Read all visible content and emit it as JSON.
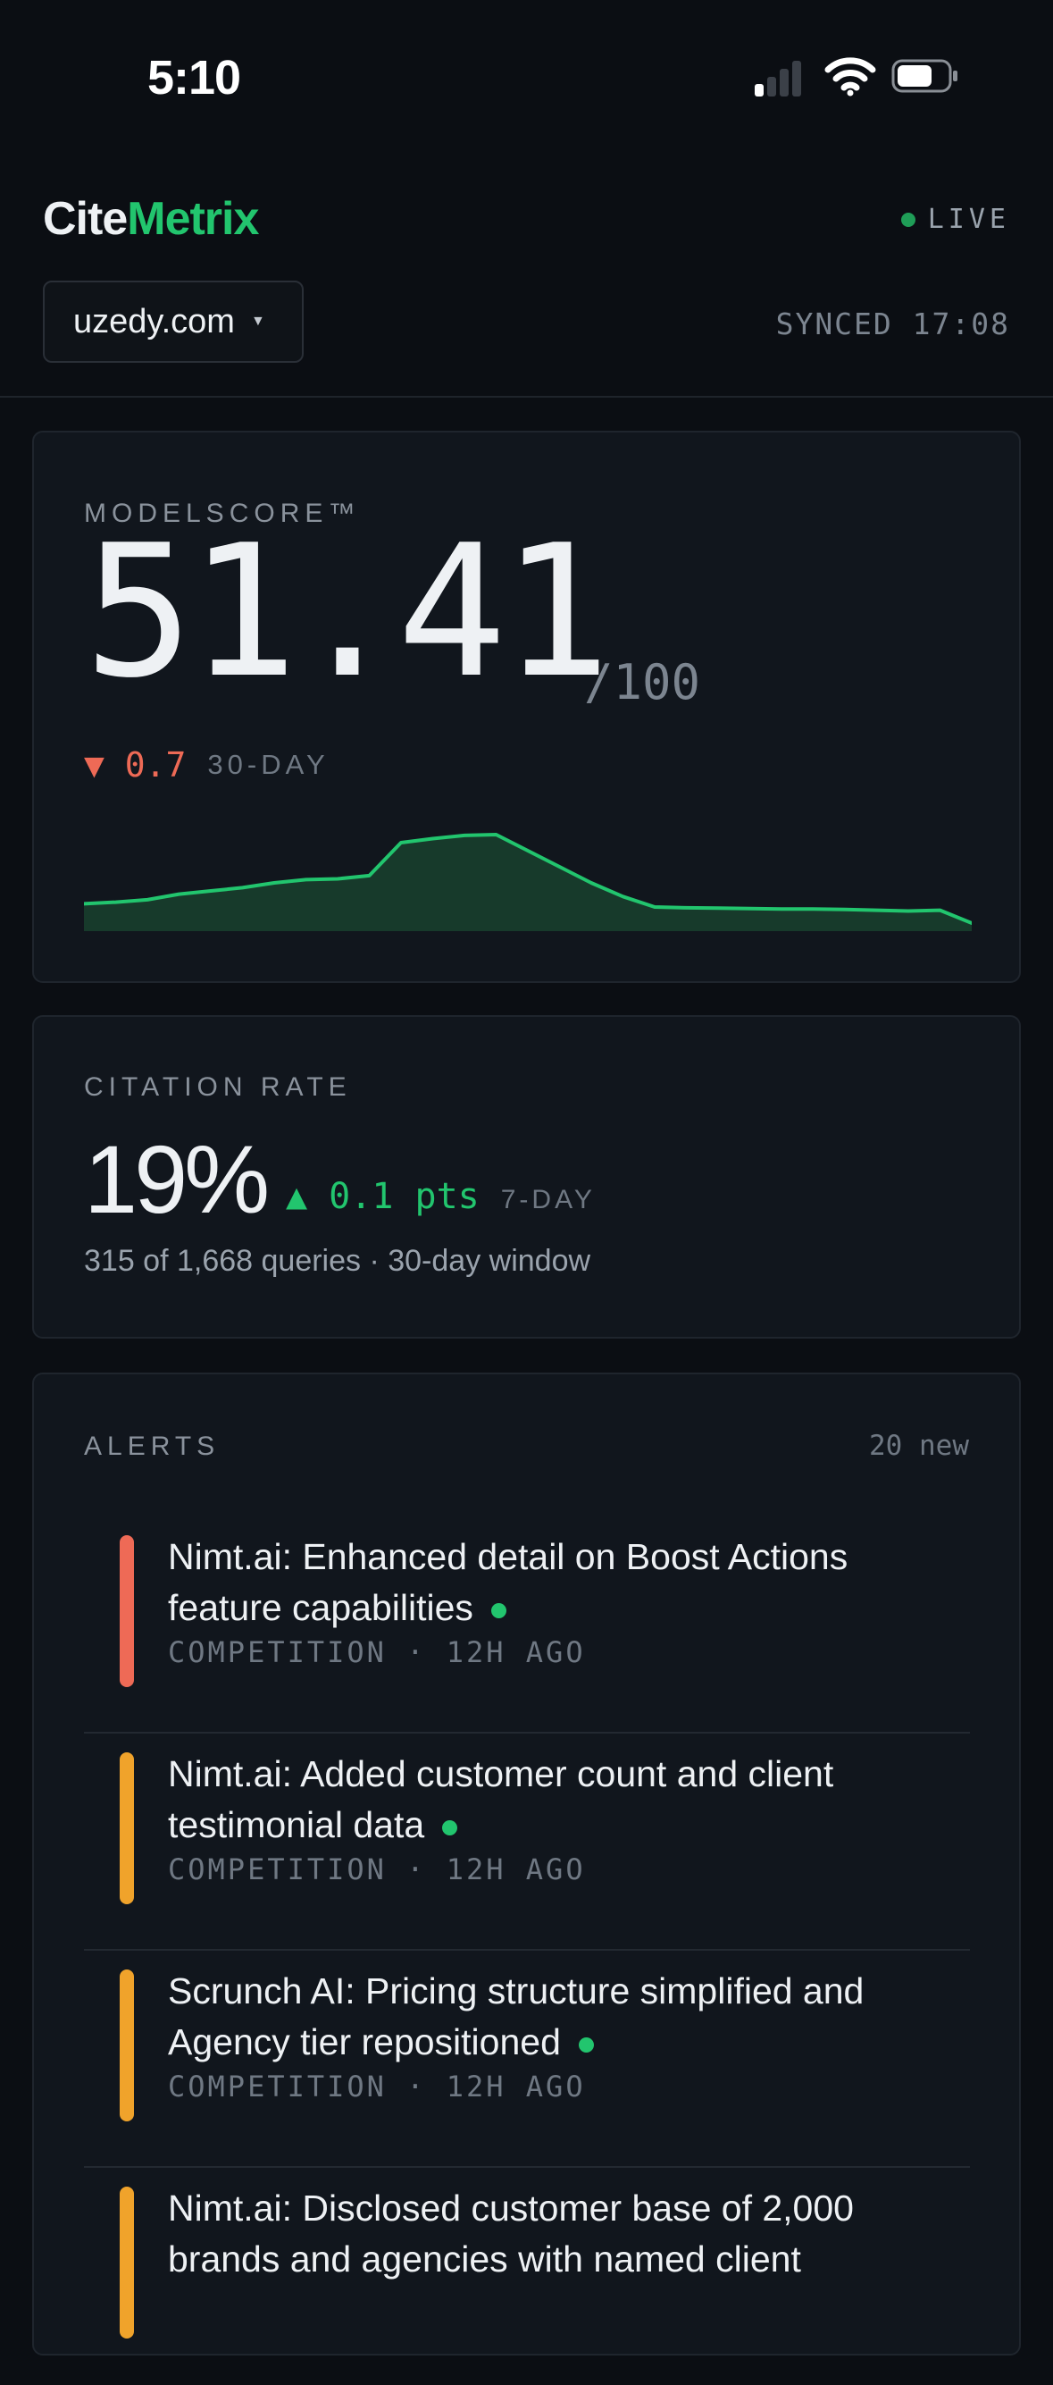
{
  "status_bar": {
    "time": "5:10"
  },
  "header": {
    "brand_part1": "Cite",
    "brand_part2": "Metrix",
    "live_label": "LIVE",
    "domain": "uzedy.com",
    "synced": "SYNCED 17:08"
  },
  "modelscore": {
    "label": "MODELSCORE™",
    "value": "51.41",
    "max": "/100",
    "delta": "▼ 0.7",
    "delta_period": "30-DAY",
    "sparkline_values": [
      3.4,
      3.6,
      3.9,
      4.6,
      5.0,
      5.4,
      6.0,
      6.4,
      6.5,
      6.9,
      11.0,
      11.5,
      11.9,
      12.0,
      10.0,
      8.0,
      6.0,
      4.3,
      3.0,
      2.9,
      2.85,
      2.8,
      2.75,
      2.75,
      2.7,
      2.6,
      2.5,
      2.6,
      1.0
    ],
    "accent": "#22c56e"
  },
  "citation_rate": {
    "label": "CITATION RATE",
    "value": "19%",
    "delta": "▲ 0.1 pts",
    "delta_period": "7-DAY",
    "subtitle": "315 of 1,668 queries · 30-day window"
  },
  "alerts": {
    "label": "ALERTS",
    "new_count": "20 new",
    "items": [
      {
        "title": "Nimt.ai: Enhanced detail on Boost Actions feature capabilities",
        "meta": "COMPETITION · 12H AGO",
        "severity_color": "#ee6a56"
      },
      {
        "title": "Nimt.ai: Added customer count and client testimonial data",
        "meta": "COMPETITION · 12H AGO",
        "severity_color": "#f0a32b"
      },
      {
        "title": "Scrunch AI: Pricing structure simplified and Agency tier repositioned",
        "meta": "COMPETITION · 12H AGO",
        "severity_color": "#f0a32b"
      },
      {
        "title": "Nimt.ai: Disclosed customer base of 2,000 brands and agencies with named client",
        "meta": "",
        "severity_color": "#f0a32b"
      }
    ]
  }
}
